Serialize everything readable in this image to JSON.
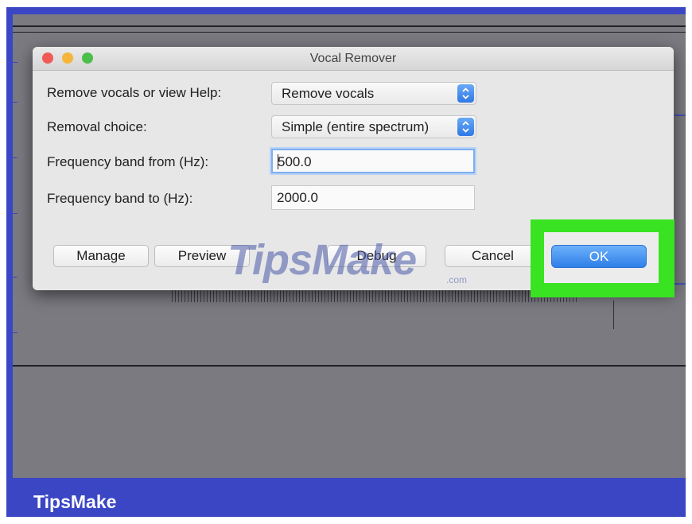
{
  "dialog": {
    "title": "Vocal Remover",
    "rows": [
      {
        "label": "Remove vocals or view Help:",
        "value": "Remove vocals"
      },
      {
        "label": "Removal choice:",
        "value": "Simple (entire spectrum)"
      },
      {
        "label": "Frequency band from (Hz):",
        "value": "500.0"
      },
      {
        "label": "Frequency band to (Hz):",
        "value": "2000.0"
      }
    ],
    "buttons": {
      "manage": "Manage",
      "preview": "Preview",
      "debug": "Debug",
      "cancel": "Cancel",
      "ok": "OK"
    }
  },
  "watermark": {
    "text": "TipsMake",
    "suffix": ".com"
  },
  "footer": {
    "brand": "TipsMake"
  },
  "colors": {
    "frame": "#3a46c4",
    "highlight": "#39e322",
    "ok_button": "#2f7fe8"
  },
  "icons": {
    "stepper": "up-down-chevron-icon"
  }
}
